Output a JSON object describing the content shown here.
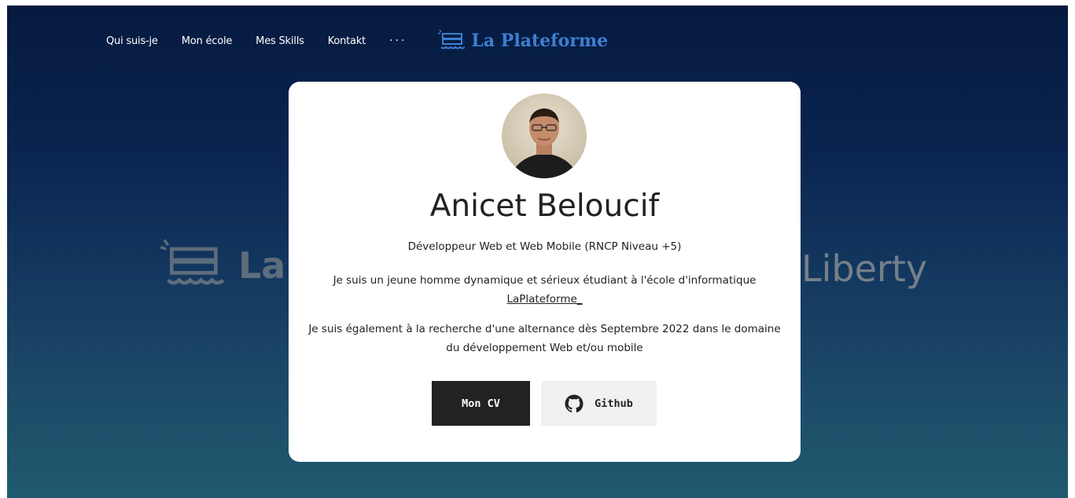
{
  "nav": {
    "items": [
      {
        "label": "Qui suis-je"
      },
      {
        "label": "Mon école"
      },
      {
        "label": "Mes Skills"
      },
      {
        "label": "Kontakt"
      }
    ],
    "more": "···",
    "brand": "La Plateforme",
    "brand_icon": "server-rack-icon"
  },
  "background": {
    "logo_text": "La",
    "right_text": "Liberty"
  },
  "card": {
    "name": "Anicet Beloucif",
    "subtitle": "Développeur Web et Web Mobile (RNCP Niveau +5)",
    "para1_text": "Je suis un jeune homme dynamique et sérieux étudiant à l'école d'informatique",
    "para1_link": "LaPlateforme_",
    "para2": "Je suis également à la recherche d'une alternance dès Septembre 2022 dans le domaine du développement Web et/ou mobile",
    "cv_button": "Mon CV",
    "github_button": "Github"
  },
  "colors": {
    "brand": "#3d7fd1",
    "dark_button": "#222222",
    "light_button": "#f1f1f1",
    "bg_top": "#061a3f",
    "bg_bottom": "#1f5a6e"
  }
}
